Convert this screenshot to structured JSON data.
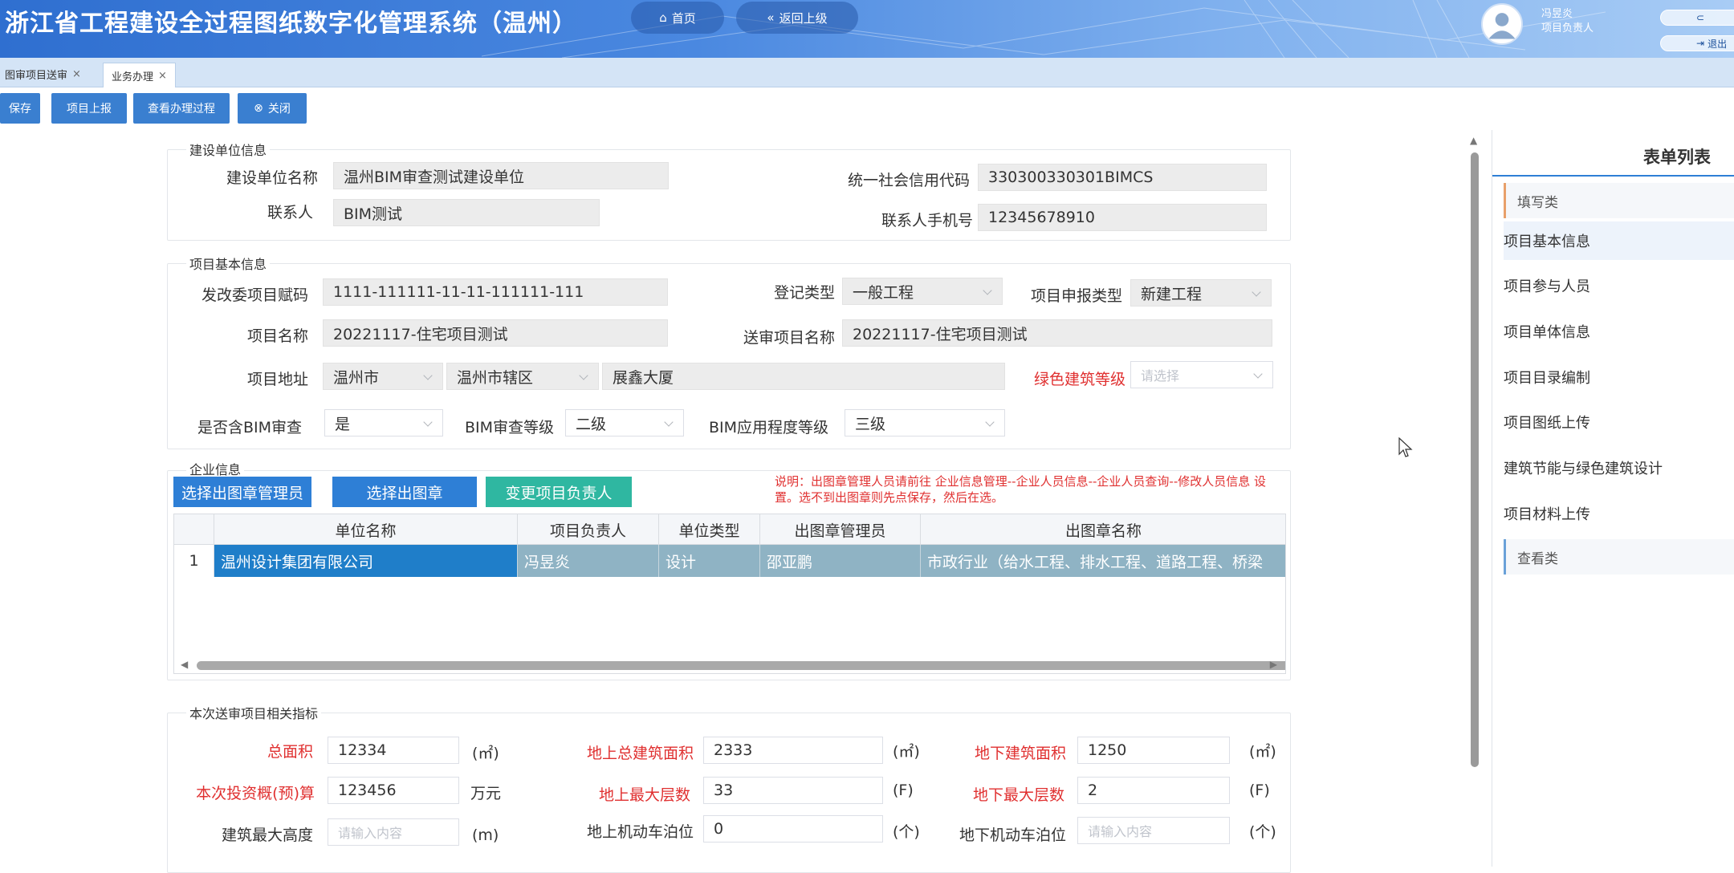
{
  "header": {
    "app_title": "浙江省工程建设全过程图纸数字化管理系统（温州）",
    "home_label": "首页",
    "back_label": "返回上级",
    "user_name": "冯昱炎",
    "user_role": "项目负责人",
    "mini_btn_1": "",
    "mini_btn_2": "退出"
  },
  "tabs": [
    {
      "label": "图审项目送审"
    },
    {
      "label": "业务办理"
    }
  ],
  "toolbar": {
    "save": "保存",
    "report": "项目上报",
    "view_process": "查看办理过程",
    "close": "关闭"
  },
  "builder": {
    "legend": "建设单位信息",
    "name_label": "建设单位名称",
    "name_value": "温州BIM审查测试建设单位",
    "credit_label": "统一社会信用代码",
    "credit_value": "330300330301BIMCS",
    "contact_label": "联系人",
    "contact_value": "BIM测试",
    "phone_label": "联系人手机号",
    "phone_value": "12345678910"
  },
  "project": {
    "legend": "项目基本信息",
    "code_label": "发改委项目赋码",
    "code_value": "1111-111111-11-11-111111-111",
    "reg_type_label": "登记类型",
    "reg_type_value": "一般工程",
    "apply_type_label": "项目申报类型",
    "apply_type_value": "新建工程",
    "name_label": "项目名称",
    "name_value": "20221117-住宅项目测试",
    "review_name_label": "送审项目名称",
    "review_name_value": "20221117-住宅项目测试",
    "address_label": "项目地址",
    "city": "温州市",
    "district": "温州市辖区",
    "address_detail": "展鑫大厦",
    "green_label": "绿色建筑等级",
    "green_placeholder": "请选择",
    "bim_label": "是否含BIM审查",
    "bim_value": "是",
    "bim_level_label": "BIM审查等级",
    "bim_level_value": "二级",
    "bim_app_label": "BIM应用程度等级",
    "bim_app_value": "三级"
  },
  "company": {
    "legend": "企业信息",
    "btn_select_manager": "选择出图章管理员",
    "btn_select_seal": "选择出图章",
    "btn_change_leader": "变更项目负责人",
    "note": "说明：出图章管理人员请前往 企业信息管理--企业人员信息--企业人员查询--修改人员信息 设置。选不到出图章则先点保存，然后在选。",
    "columns": [
      "单位名称",
      "项目负责人",
      "单位类型",
      "出图章管理员",
      "出图章名称"
    ],
    "rows": [
      {
        "num": "1",
        "cells": [
          "温州设计集团有限公司",
          "冯昱炎",
          "设计",
          "邵亚鹏",
          "市政行业（给水工程、排水工程、道路工程、桥梁"
        ]
      }
    ]
  },
  "indicators": {
    "legend": "本次送审项目相关指标",
    "total_area_label": "总面积",
    "total_area_value": "12334",
    "total_area_unit": "(㎡)",
    "above_area_label": "地上总建筑面积",
    "above_area_value": "2333",
    "above_area_unit": "(㎡)",
    "under_area_label": "地下建筑面积",
    "under_area_value": "1250",
    "under_area_unit": "(㎡)",
    "invest_label": "本次投资概(预)算",
    "invest_value": "123456",
    "invest_unit": "万元",
    "above_floors_label": "地上最大层数",
    "above_floors_value": "33",
    "above_floors_unit": "(F)",
    "under_floors_label": "地下最大层数",
    "under_floors_value": "2",
    "under_floors_unit": "(F)",
    "height_label": "建筑最大高度",
    "height_placeholder": "请输入内容",
    "height_unit": "(m)",
    "above_parking_label": "地上机动车泊位",
    "above_parking_value": "0",
    "above_parking_unit": "(个)",
    "under_parking_label": "地下机动车泊位",
    "under_parking_placeholder": "请输入内容",
    "under_parking_unit": "(个)"
  },
  "right_panel": {
    "title": "表单列表",
    "group_fill": "填写类",
    "items": [
      "项目基本信息",
      "项目参与人员",
      "项目单体信息",
      "项目目录编制",
      "项目图纸上传",
      "建筑节能与绿色建筑设计",
      "项目材料上传"
    ],
    "group_view": "查看类"
  }
}
